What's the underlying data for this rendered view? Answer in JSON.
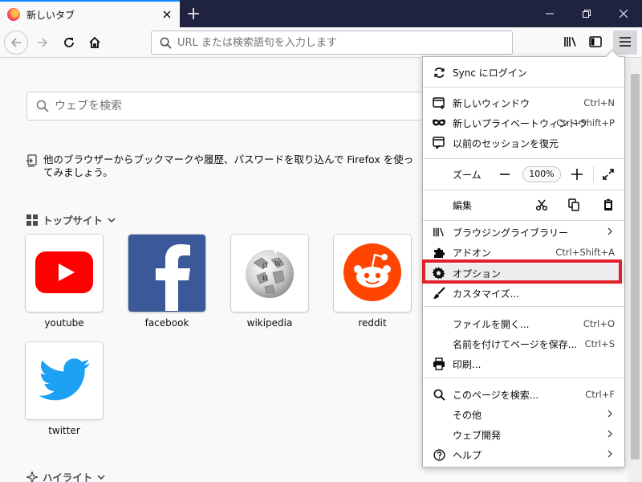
{
  "tab": {
    "title": "新しいタブ"
  },
  "urlbar": {
    "placeholder": "URL または検索語句を入力します"
  },
  "search": {
    "placeholder": "ウェブを検索"
  },
  "import_message": "他のブラウザーからブックマークや履歴、パスワードを取り込んで Firefox を使ってみましょう。",
  "top_sites": {
    "title": "トップサイト",
    "sites": [
      {
        "label": "youtube"
      },
      {
        "label": "facebook"
      },
      {
        "label": "wikipedia"
      },
      {
        "label": "reddit"
      },
      {
        "label": "twitter"
      }
    ]
  },
  "highlights": {
    "title": "ハイライト"
  },
  "menu": {
    "sync": "Sync にログイン",
    "new_window": {
      "label": "新しいウィンドウ",
      "shortcut": "Ctrl+N"
    },
    "private_window": {
      "label": "新しいプライベートウィンドウ",
      "shortcut": "Ctrl+Shift+P"
    },
    "restore_session": "以前のセッションを復元",
    "zoom": {
      "label": "ズーム",
      "value": "100%"
    },
    "edit": "編集",
    "library": "ブラウジングライブラリー",
    "addons": {
      "label": "アドオン",
      "shortcut": "Ctrl+Shift+A"
    },
    "options": "オプション",
    "customize": "カスタマイズ...",
    "open_file": {
      "label": "ファイルを開く...",
      "shortcut": "Ctrl+O"
    },
    "save_page": {
      "label": "名前を付けてページを保存...",
      "shortcut": "Ctrl+S"
    },
    "print": "印刷...",
    "find": {
      "label": "このページを検索...",
      "shortcut": "Ctrl+F"
    },
    "more": "その他",
    "web_developer": "ウェブ開発",
    "help": "ヘルプ"
  },
  "colors": {
    "titlebar": "#202340",
    "highlight_box": "#e0202a",
    "accent": "#0a84ff"
  }
}
